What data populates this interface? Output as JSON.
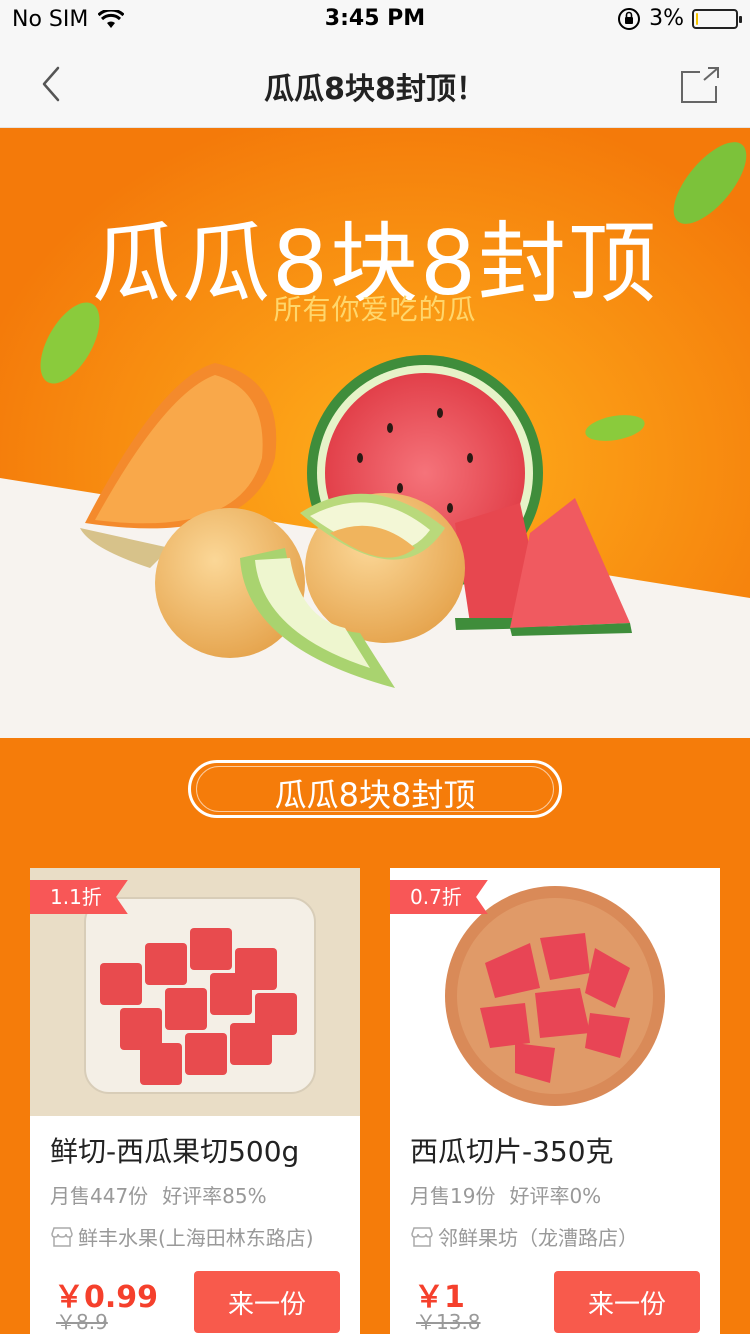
{
  "status_bar": {
    "carrier": "No SIM",
    "time": "3:45 PM",
    "battery_percent": "3%",
    "battery_level": 0.03
  },
  "nav": {
    "title": "瓜瓜8块8封顶！",
    "back_icon": "chevron-left-icon",
    "share_icon": "share-icon"
  },
  "banner": {
    "title": "瓜瓜8块8封顶",
    "subtitle": "所有你爱吃的瓜"
  },
  "section": {
    "title": "瓜瓜8块8封顶"
  },
  "products": [
    {
      "discount": "1.1折",
      "name": "鲜切-西瓜果切500g",
      "monthly_sales": "月售447份",
      "rating": "好评率85%",
      "shop": "鲜丰水果(上海田林东路店)",
      "price": "￥0.99",
      "original_price": "￥8.9",
      "button": "来一份"
    },
    {
      "discount": "0.7折",
      "name": "西瓜切片-350克",
      "monthly_sales": "月售19份",
      "rating": "好评率0%",
      "shop": "邻鲜果坊（龙漕路店）",
      "price": "￥1",
      "original_price": "￥13.8",
      "button": "来一份"
    }
  ],
  "colors": {
    "brand_orange": "#f57c0a",
    "price_red": "#f5402c",
    "button_red": "#f85a4c",
    "discount_red": "#f85757"
  }
}
